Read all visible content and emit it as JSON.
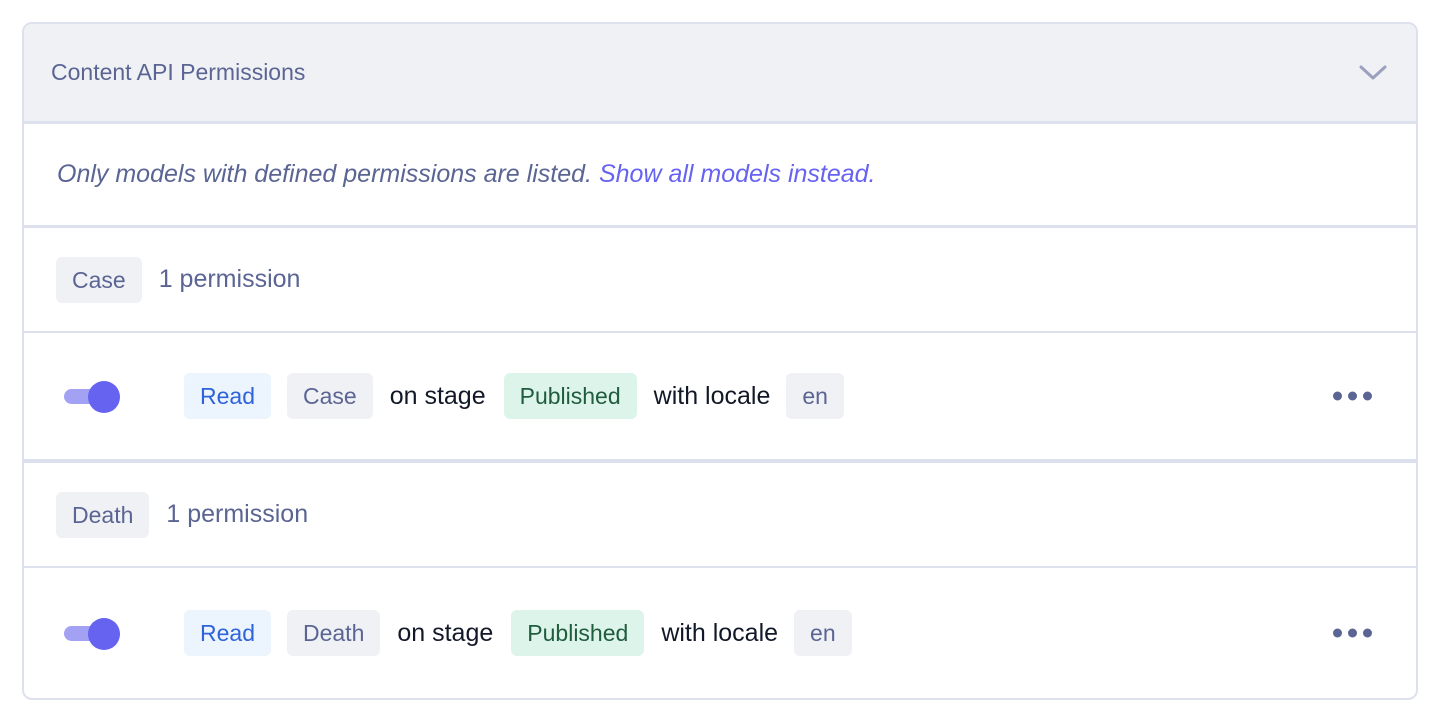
{
  "header": {
    "title": "Content API Permissions",
    "chevron_icon": "chevron-down-icon"
  },
  "notice": {
    "text": "Only models with defined permissions are listed.",
    "link": "Show all models instead."
  },
  "groups": [
    {
      "model": "Case",
      "count_label": "1 permission",
      "permissions": [
        {
          "enabled": true,
          "action": "Read",
          "model": "Case",
          "on_stage_text": "on stage",
          "stage": "Published",
          "with_locale_text": "with locale",
          "locale": "en",
          "menu_icon": "more-horizontal-icon"
        }
      ]
    },
    {
      "model": "Death",
      "count_label": "1 permission",
      "permissions": [
        {
          "enabled": true,
          "action": "Read",
          "model": "Death",
          "on_stage_text": "on stage",
          "stage": "Published",
          "with_locale_text": "with locale",
          "locale": "en",
          "menu_icon": "more-horizontal-icon"
        }
      ]
    }
  ],
  "colors": {
    "accent": "#6663f0",
    "read_chip_text": "#2f63d8",
    "published_chip_bg": "#ddf4ea",
    "published_chip_text": "#205c3e",
    "muted_text": "#5b6593"
  }
}
